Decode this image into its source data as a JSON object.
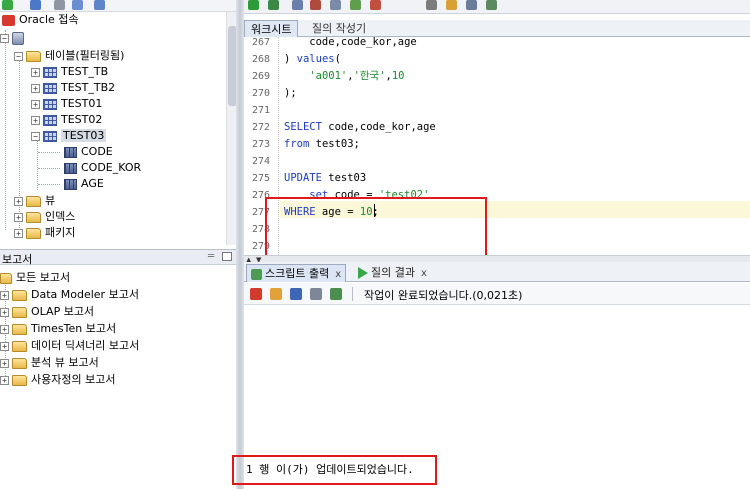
{
  "connections": {
    "root_label": "Oracle 접속",
    "tables_folder": "테이블(필터링됨)",
    "tables": [
      "TEST_TB",
      "TEST_TB2",
      "TEST01",
      "TEST02",
      "TEST03"
    ],
    "columns": [
      "CODE",
      "CODE_KOR",
      "AGE"
    ],
    "views_folder": "뷰",
    "indexes_folder": "인덱스",
    "packages_folder": "패키지"
  },
  "reports": {
    "title": "보고서",
    "items": [
      "모든 보고서",
      "Data Modeler 보고서",
      "OLAP 보고서",
      "TimesTen 보고서",
      "데이터 딕셔너리 보고서",
      "분석 뷰 보고서",
      "사용자정의 보고서"
    ]
  },
  "editor": {
    "tabs": [
      "워크시트",
      "질의 작성기"
    ],
    "lines": [
      {
        "n": "267",
        "text": "    code,code_kor,age"
      },
      {
        "n": "268",
        "text": ") values("
      },
      {
        "n": "269",
        "text": "    'a001','한국',10"
      },
      {
        "n": "270",
        "text": ");"
      },
      {
        "n": "271",
        "text": ""
      },
      {
        "n": "272",
        "text": "SELECT code,code_kor,age"
      },
      {
        "n": "273",
        "text": "from test03;"
      },
      {
        "n": "274",
        "text": ""
      },
      {
        "n": "275",
        "text": "UPDATE test03"
      },
      {
        "n": "276",
        "text": "    set code = 'test02'"
      },
      {
        "n": "277",
        "text": "WHERE age = 10;"
      },
      {
        "n": "278",
        "text": ""
      },
      {
        "n": "279",
        "text": ""
      }
    ]
  },
  "output": {
    "tab_script": "스크립트 출력",
    "tab_result": "질의 결과",
    "close_glyph": "x",
    "status": "작업이 완료되었습니다.(0,021초)",
    "result_line": "1 행 이(가)  업데이트되었습니다."
  },
  "colors": {
    "highlight_box": "#e01a1a",
    "keyword": "#1f3bbf",
    "string": "#1a8b2a"
  }
}
